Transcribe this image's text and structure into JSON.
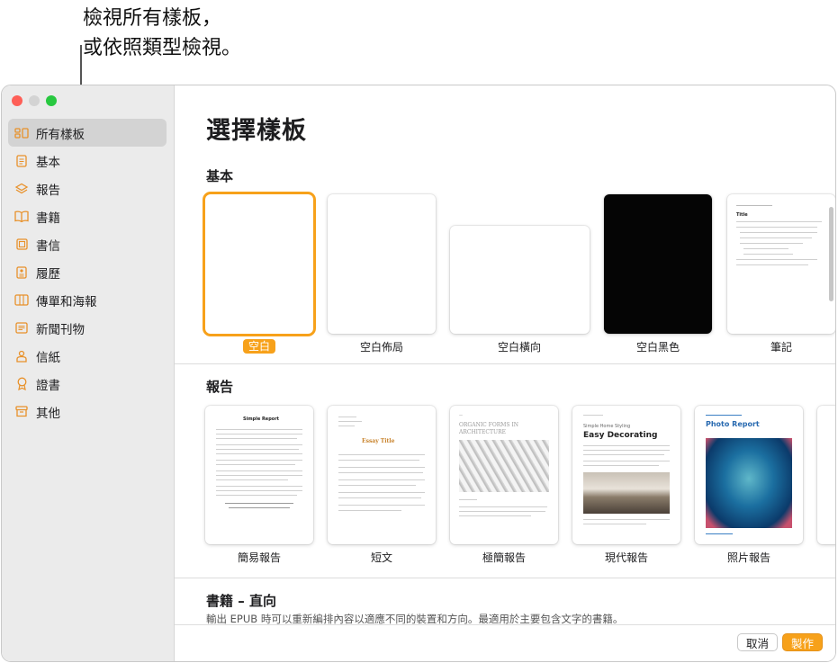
{
  "callout": {
    "line1": "檢視所有樣板，",
    "line2": "或依照類型檢視。"
  },
  "sidebar": {
    "items": [
      {
        "label": "所有樣板",
        "icon": "grid-icon"
      },
      {
        "label": "基本",
        "icon": "document-icon"
      },
      {
        "label": "報告",
        "icon": "report-icon"
      },
      {
        "label": "書籍",
        "icon": "book-icon"
      },
      {
        "label": "書信",
        "icon": "letter-icon"
      },
      {
        "label": "履歷",
        "icon": "resume-icon"
      },
      {
        "label": "傳單和海報",
        "icon": "poster-icon"
      },
      {
        "label": "新聞刊物",
        "icon": "newsletter-icon"
      },
      {
        "label": "信紙",
        "icon": "stationery-icon"
      },
      {
        "label": "證書",
        "icon": "certificate-icon"
      },
      {
        "label": "其他",
        "icon": "tray-icon"
      }
    ],
    "selected": "所有樣板"
  },
  "main": {
    "title": "選擇樣板",
    "basic": {
      "heading": "基本",
      "templates": [
        "空白",
        "空白佈局",
        "空白橫向",
        "空白黑色",
        "筆記"
      ]
    },
    "reports": {
      "heading": "報告",
      "templates": [
        "簡易報告",
        "短文",
        "極簡報告",
        "現代報告",
        "照片報告"
      ]
    },
    "books": {
      "heading": "書籍 – 直向",
      "description": "輸出 EPUB 時可以重新編排內容以適應不同的裝置和方向。最適用於主要包含文字的書籍。"
    }
  },
  "thumbnails": {
    "notes_title": "Title",
    "simple_report_title": "Simple Report",
    "essay_title": "Essay Title",
    "minimal_report_title": "ORGANIC FORMS IN ARCHITECTURE",
    "modern_report_small": "Simple Home Styling",
    "modern_report_title": "Easy Decorating",
    "photo_report_title": "Photo Report"
  },
  "buttons": {
    "cancel": "取消",
    "create": "製作"
  },
  "colors": {
    "accent": "#f7a11a",
    "sidebar_bg": "#ebebeb",
    "selection": "#d3d3d3",
    "icon_orange": "#e8912a"
  }
}
